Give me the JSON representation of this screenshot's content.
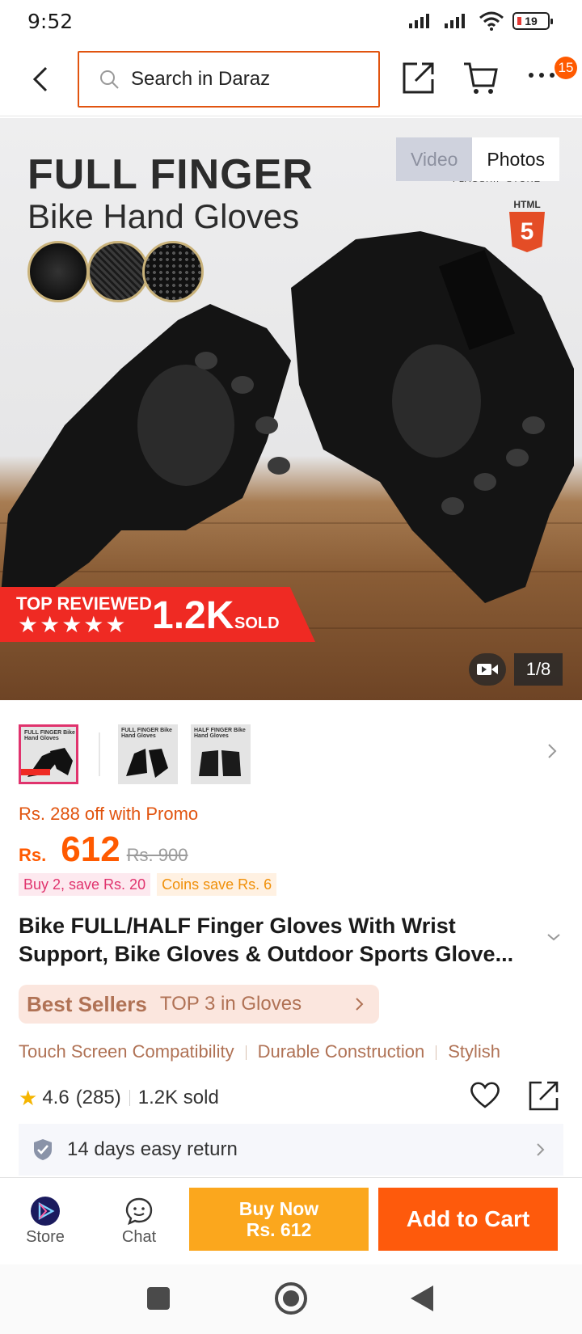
{
  "status": {
    "time": "9:52",
    "battery": "19"
  },
  "header": {
    "search_placeholder": "Search in Daraz",
    "cart_badge": "15"
  },
  "hero": {
    "title_line1": "FULL FINGER",
    "title_line2": "Bike Hand Gloves",
    "html5_label": "HTML",
    "html5_mark": "5",
    "store_text": "FLAGSHIP STORE",
    "tabs": {
      "video": "Video",
      "photos": "Photos"
    },
    "ribbon_top": "TOP REVIEWED",
    "ribbon_stars": "★★★★★",
    "ribbon_count": "1.2K",
    "ribbon_sold": "SOLD",
    "counter": "1/8"
  },
  "thumbnails": [
    {
      "label": "FULL FINGER Bike Hand Gloves"
    },
    {
      "label": "FULL FINGER Bike Hand Gloves"
    },
    {
      "label": "HALF FINGER Bike Hand Gloves"
    }
  ],
  "price": {
    "promo": "Rs. 288 off with Promo",
    "currency": "Rs.",
    "amount": "612",
    "original": "Rs. 900",
    "chips": [
      "Buy 2, save Rs. 20",
      "Coins save Rs. 6"
    ]
  },
  "product": {
    "title": "Bike FULL/HALF Finger Gloves With Wrist Support, Bike Gloves & Outdoor Sports Glove...",
    "bestseller_label": "Best Sellers",
    "bestseller_rank": "TOP 3 in Gloves",
    "features": [
      "Touch Screen Compatibility",
      "Durable Construction",
      "Stylish"
    ],
    "rating": "4.6",
    "reviews": "(285)",
    "sold": "1.2K sold",
    "returns": "14 days easy return"
  },
  "bottom_bar": {
    "store": "Store",
    "chat": "Chat",
    "buy_now_line1": "Buy Now",
    "buy_now_line2": "Rs. 612",
    "add_to_cart": "Add to Cart"
  },
  "colors": {
    "accent": "#fe5a0c",
    "buy_now": "#fba71d",
    "promo": "#e1540f",
    "chip_pink": "#e0336d"
  }
}
